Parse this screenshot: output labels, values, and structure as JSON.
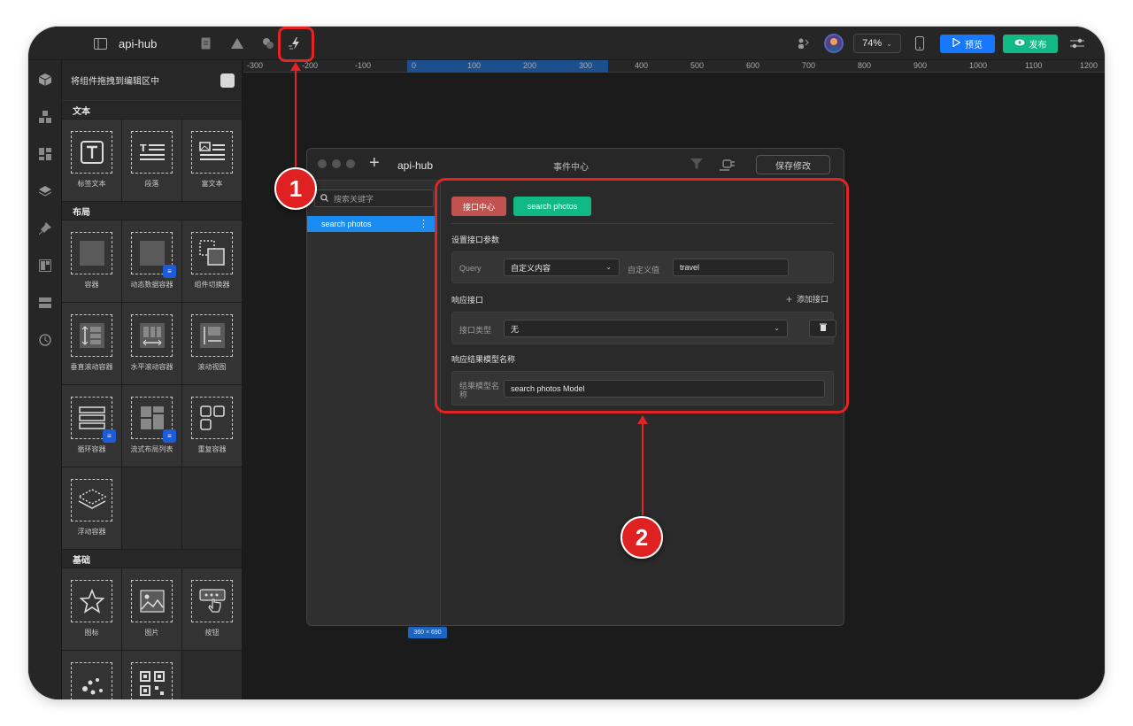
{
  "app": {
    "title": "api-hub"
  },
  "toolbar": {
    "zoom": "74%",
    "preview_label": "预览",
    "publish_label": "发布",
    "colors": {
      "preview": "#1677ff",
      "publish": "#12b886"
    }
  },
  "ruler": {
    "labels": [
      "-300",
      "-200",
      "-100",
      "0",
      "100",
      "200",
      "300",
      "400",
      "500",
      "600",
      "700",
      "800",
      "900",
      "1000",
      "1100",
      "1200"
    ]
  },
  "panel": {
    "title": "将组件拖拽到编辑区中",
    "sections": [
      {
        "title": "文本",
        "items": [
          "标签文本",
          "段落",
          "富文本"
        ]
      },
      {
        "title": "布局",
        "items": [
          "容器",
          "动态数据容器",
          "组件切换器",
          "垂直滚动容器",
          "水平滚动容器",
          "滚动视图",
          "循环容器",
          "流式布局列表",
          "重复容器",
          "浮动容器"
        ]
      },
      {
        "title": "基础",
        "items": [
          "图标",
          "图片",
          "按钮"
        ]
      }
    ]
  },
  "event_window": {
    "app_name": "api-hub",
    "title": "事件中心",
    "save_label": "保存修改",
    "search_placeholder": "搜索关键字",
    "list_items": [
      "search photos"
    ],
    "tabs": [
      "接口中心",
      "search photos"
    ],
    "section_params": "设置接口参数",
    "param_key": "Query",
    "param_type": "自定义内容",
    "param_value_label": "自定义值",
    "param_value": "travel",
    "section_response": "响应接口",
    "add_response": "添加接口",
    "response_type_label": "接口类型",
    "response_type_value": "无",
    "section_model": "响应结果模型名称",
    "model_label": "结果模型名称",
    "model_value": "search photos Model",
    "size_tag": "360 × 690"
  },
  "annotations": {
    "badge1": "1",
    "badge2": "2",
    "color": "#e32424"
  }
}
